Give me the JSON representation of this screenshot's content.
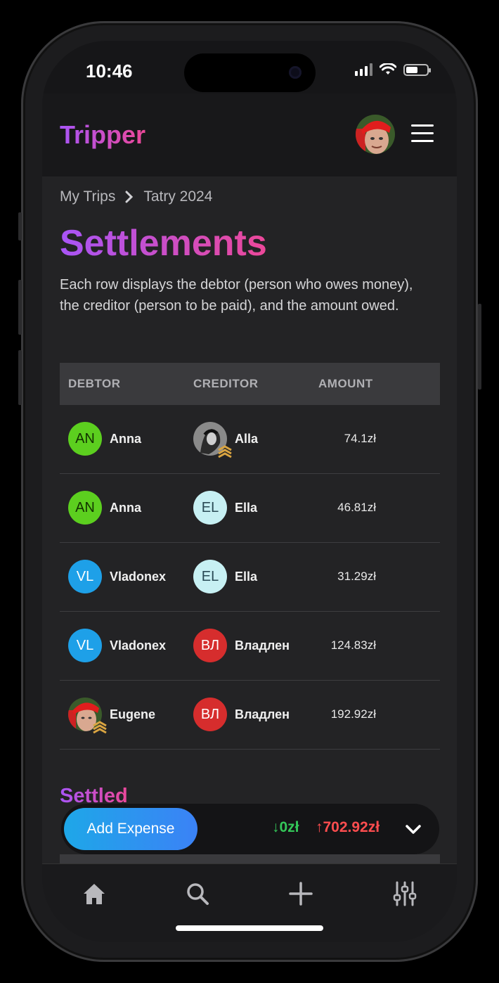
{
  "status": {
    "time": "10:46"
  },
  "header": {
    "logo": "Tripper"
  },
  "breadcrumb": {
    "items": [
      "My Trips",
      "Tatry 2024"
    ]
  },
  "page": {
    "title": "Settlements",
    "description": "Each row displays the debtor (person who owes money), the creditor (person to be paid), and the amount owed."
  },
  "table": {
    "headers": {
      "debtor": "DEBTOR",
      "creditor": "CREDITOR",
      "amount": "AMOUNT"
    },
    "rows": [
      {
        "debtor": {
          "initials": "AN",
          "name": "Anna",
          "color": "#5ccf1f",
          "text": "#123300"
        },
        "creditor": {
          "initials": "",
          "name": "Alla",
          "photo": true
        },
        "amount": "74.1zł"
      },
      {
        "debtor": {
          "initials": "AN",
          "name": "Anna",
          "color": "#5ccf1f",
          "text": "#123300"
        },
        "creditor": {
          "initials": "EL",
          "name": "Ella",
          "color": "#c7f0f3",
          "text": "#2a4a55"
        },
        "amount": "46.81zł"
      },
      {
        "debtor": {
          "initials": "VL",
          "name": "Vladonex",
          "color": "#1ea0e8",
          "text": "#ffffff"
        },
        "creditor": {
          "initials": "EL",
          "name": "Ella",
          "color": "#c7f0f3",
          "text": "#2a4a55"
        },
        "amount": "31.29zł"
      },
      {
        "debtor": {
          "initials": "VL",
          "name": "Vladonex",
          "color": "#1ea0e8",
          "text": "#ffffff"
        },
        "creditor": {
          "initials": "ВЛ",
          "name": "Владлен",
          "color": "#d62d2d",
          "text": "#ffffff"
        },
        "amount": "124.83zł"
      },
      {
        "debtor": {
          "initials": "",
          "name": "Eugene",
          "photo": true
        },
        "creditor": {
          "initials": "ВЛ",
          "name": "Владлен",
          "color": "#d62d2d",
          "text": "#ffffff"
        },
        "amount": "192.92zł"
      }
    ]
  },
  "settled": {
    "title": "Settled"
  },
  "actionbar": {
    "add_label": "Add Expense",
    "balance_down": "↓0zł",
    "balance_up": "↑702.92zł"
  },
  "tabbar": {
    "icons": [
      "home-icon",
      "search-icon",
      "plus-icon",
      "sliders-icon"
    ]
  },
  "colors": {
    "accent_gradient": [
      "#a855f7",
      "#ec4899"
    ],
    "positive": "#34c759",
    "negative": "#ff4d4f"
  }
}
